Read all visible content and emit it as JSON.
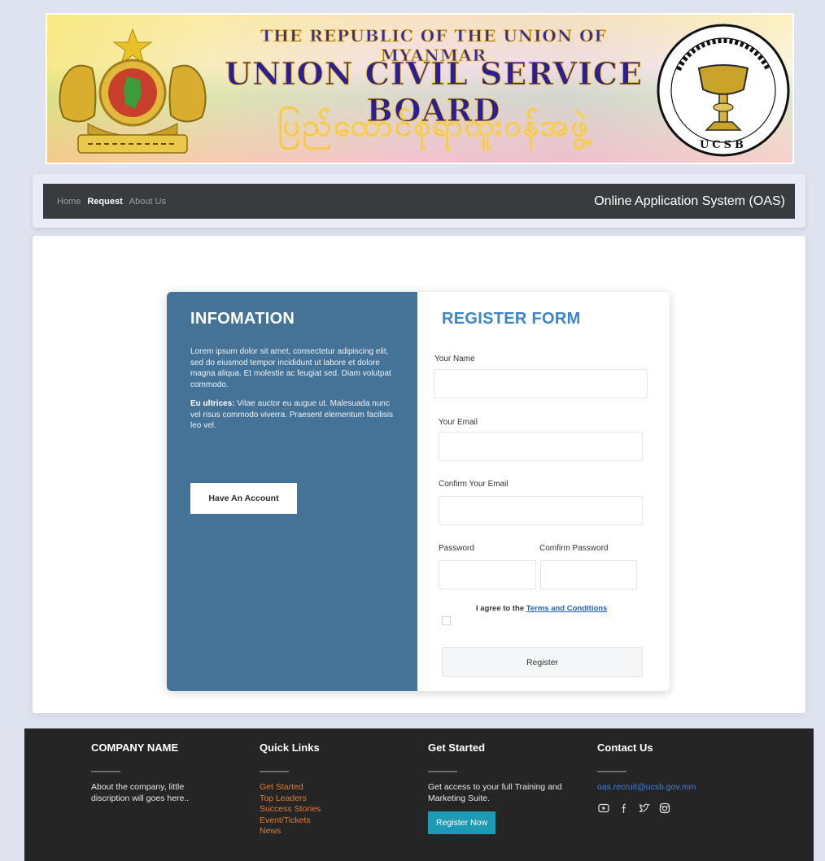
{
  "banner": {
    "title_line1": "THE REPUBLIC OF THE UNION OF MYANMAR",
    "title_line2": "UNION CIVIL SERVICE BOARD",
    "title_line3": "ပြည်ထောင်စုရာထူးဝန်အဖွဲ့",
    "seal_text": "UCSB",
    "emblem_icon": "state-emblem-icon",
    "seal_icon": "ucsb-seal-icon"
  },
  "nav": {
    "links": [
      "Home",
      "Request",
      "About Us"
    ],
    "active": "Request",
    "brand": "Online Application System (OAS)"
  },
  "info": {
    "title": "INFOMATION",
    "paragraph1": "Lorem ipsum dolor sit amet, consectetur adipiscing elit, sed do eiusmod tempor incididunt ut labore et dolore magna aliqua. Et molestie ac feugiat sed. Diam volutpat commodo.",
    "paragraph2_bold": "Eu ultrices:",
    "paragraph2": " Vitae auctor eu augue ut. Malesuada nunc vel risus commodo viverra. Praesent elementum facilisis leo vel.",
    "button": "Have An Account"
  },
  "form": {
    "title": "REGISTER FORM",
    "name_label": "Your Name",
    "email_label": "Your Email",
    "confirm_email_label": "Confirm Your Email",
    "password_label": "Password",
    "confirm_password_label": "Comfirm Password",
    "name_value": "",
    "email_value": "",
    "confirm_email_value": "",
    "agree_text": "I agree to the ",
    "terms_link": "Terms and Conditions",
    "checked": false,
    "register_button": "Register"
  },
  "footer": {
    "company_heading": "COMPANY NAME",
    "company_text": "About the company, little discription will goes here..",
    "quick_heading": "Quick Links",
    "quick_links": [
      "Get Started",
      "Top Leaders",
      "Success Stories",
      "Event/Tickets",
      "News"
    ],
    "started_heading": "Get Started",
    "started_text": "Get access to your full Training and Marketing Suite.",
    "started_button": "Register Now",
    "contact_heading": "Contact Us",
    "contact_email": "oas.recruit@ucsb.gov.mm",
    "social_icons": [
      "youtube-icon",
      "facebook-icon",
      "twitter-icon",
      "instagram-icon"
    ],
    "colors": {
      "link": "#e07b2c",
      "button": "#1d9bb5",
      "email": "#3d7fdc"
    }
  },
  "colors": {
    "info_panel": "#447397",
    "form_title": "#3b86c6",
    "navbar": "#3a3b3f"
  }
}
